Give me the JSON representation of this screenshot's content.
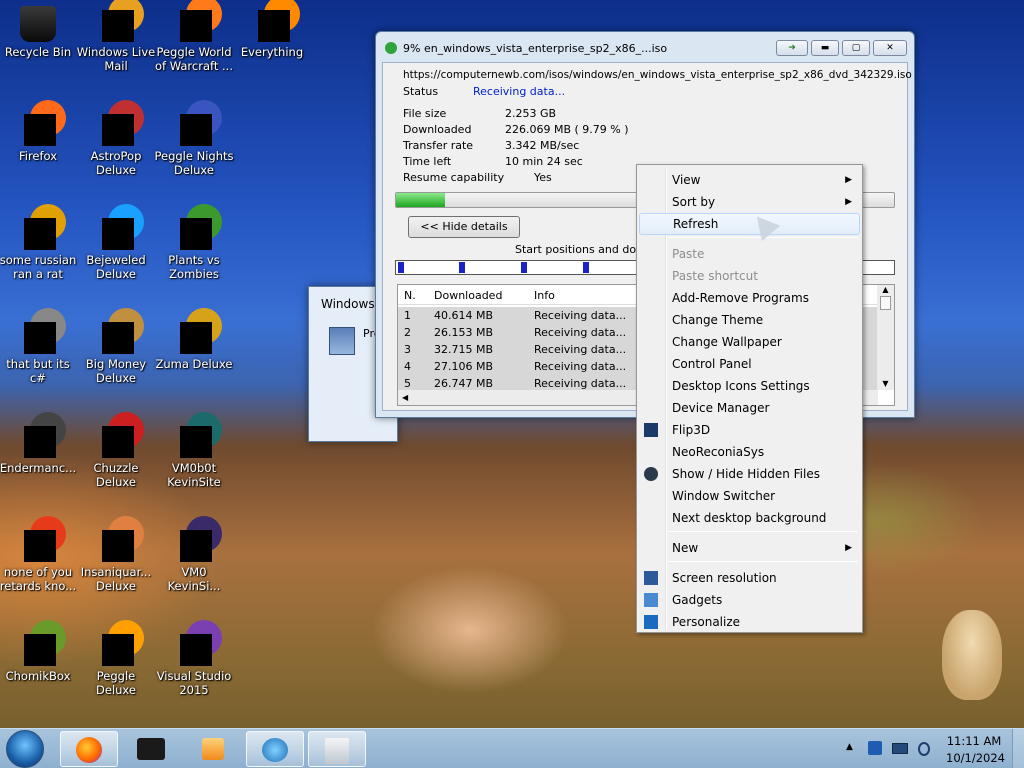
{
  "desktop_icons": [
    {
      "label": "Recycle Bin",
      "icon": "recycle-bin-icon"
    },
    {
      "label": "Windows Live\nMail",
      "icon": "mail-icon"
    },
    {
      "label": "Peggle World\nof Warcraft ...",
      "icon": "peggle-icon"
    },
    {
      "label": "Everything",
      "icon": "search-icon"
    },
    {
      "label": "Firefox",
      "icon": "firefox-icon"
    },
    {
      "label": "AstroPop\nDeluxe",
      "icon": "game-icon"
    },
    {
      "label": "Peggle Nights\nDeluxe",
      "icon": "peggle-icon"
    },
    {
      "label": "some russian\nran a rat",
      "icon": "app-icon"
    },
    {
      "label": "Bejeweled\nDeluxe",
      "icon": "gem-icon"
    },
    {
      "label": "Plants vs\nZombies",
      "icon": "game-icon"
    },
    {
      "label": "that but its c#",
      "icon": "app-icon"
    },
    {
      "label": "Big Money\nDeluxe",
      "icon": "game-icon"
    },
    {
      "label": "Zuma Deluxe",
      "icon": "game-icon"
    },
    {
      "label": "Endermanc...",
      "icon": "app-icon"
    },
    {
      "label": "Chuzzle\nDeluxe",
      "icon": "game-icon"
    },
    {
      "label": "VM0b0t\nKevinSite",
      "icon": "vm-icon"
    },
    {
      "label": "none of you\nretards kno...",
      "icon": "app-icon"
    },
    {
      "label": "Insaniquar...\nDeluxe",
      "icon": "game-icon"
    },
    {
      "label": "VM0\nKevinSi...",
      "icon": "vm-icon"
    },
    {
      "label": "ChomikBox",
      "icon": "app-icon"
    },
    {
      "label": "Peggle Deluxe",
      "icon": "peggle-icon"
    },
    {
      "label": "Visual Studio\n2015",
      "icon": "visual-studio-icon"
    }
  ],
  "behind_window": {
    "title": "Windows I",
    "text": "Pre"
  },
  "download": {
    "title": "9% en_windows_vista_enterprise_sp2_x86_...iso",
    "url": "https://computernewb.com/isos/windows/en_windows_vista_enterprise_sp2_x86_dvd_342329.iso",
    "status_label": "Status",
    "status_value": "Receiving data...",
    "fields": [
      {
        "label": "File size",
        "value": "2.253  GB"
      },
      {
        "label": "Downloaded",
        "value": "226.069  MB  ( 9.79 % )"
      },
      {
        "label": "Transfer rate",
        "value": "3.342  MB/sec"
      },
      {
        "label": "Time left",
        "value": "10 min 24 sec"
      },
      {
        "label": "Resume capability",
        "value": "Yes"
      }
    ],
    "progress": 0.0979,
    "hide_details": "<< Hide details",
    "start_positions": "Start positions and downl",
    "columns": [
      "N.",
      "Downloaded",
      "Info"
    ],
    "rows": [
      {
        "n": "1",
        "dl": "40.614  MB",
        "info": "Receiving data..."
      },
      {
        "n": "2",
        "dl": "26.153  MB",
        "info": "Receiving data..."
      },
      {
        "n": "3",
        "dl": "32.715  MB",
        "info": "Receiving data..."
      },
      {
        "n": "4",
        "dl": "27.106  MB",
        "info": "Receiving data..."
      },
      {
        "n": "5",
        "dl": "26.747  MB",
        "info": "Receiving data..."
      }
    ]
  },
  "context_menu": {
    "items": [
      {
        "label": "View",
        "submenu": true
      },
      {
        "label": "Sort by",
        "submenu": true
      },
      {
        "label": "Refresh",
        "highlight": true
      },
      {
        "label": "Paste",
        "disabled": true
      },
      {
        "label": "Paste shortcut",
        "disabled": true
      },
      {
        "label": "Add-Remove Programs"
      },
      {
        "label": "Change Theme"
      },
      {
        "label": "Change Wallpaper"
      },
      {
        "label": "Control Panel"
      },
      {
        "label": "Desktop Icons Settings"
      },
      {
        "label": "Device Manager"
      },
      {
        "label": "Flip3D",
        "icon": "flip3d-icon"
      },
      {
        "label": "NeoReconiaSys"
      },
      {
        "label": "Show / Hide Hidden Files",
        "icon": "globe-icon"
      },
      {
        "label": "Window Switcher"
      },
      {
        "label": "Next desktop background"
      },
      {
        "label": "New",
        "submenu": true
      },
      {
        "label": "Screen resolution",
        "icon": "monitor-icon"
      },
      {
        "label": "Gadgets",
        "icon": "gadgets-icon"
      },
      {
        "label": "Personalize",
        "icon": "personalize-icon"
      }
    ]
  },
  "taskbar": {
    "apps": [
      "start-orb-icon",
      "firefox-icon",
      "idm-tray-icon",
      "media-player-icon",
      "idm-icon",
      "explorer-icon"
    ],
    "time": "11:11 AM",
    "date": "10/1/2024"
  },
  "colors": {
    "accent": "#3b6fc4",
    "progress": "#1fa61f",
    "status": "#0022cc"
  }
}
